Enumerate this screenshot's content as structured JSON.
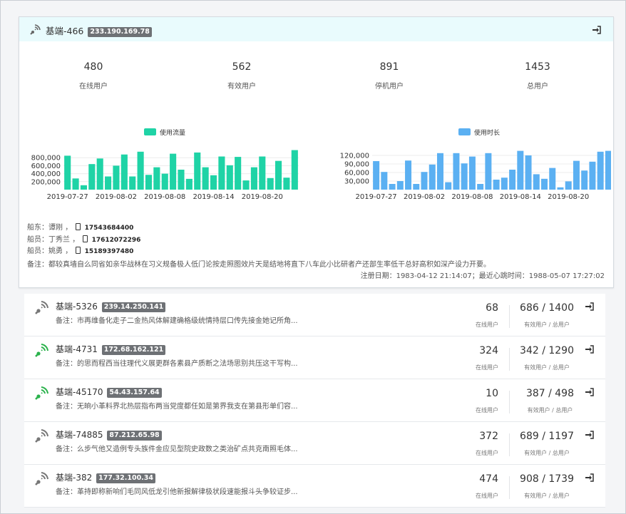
{
  "main": {
    "title": "基端-466",
    "ip": "233.190.169.78",
    "stats": [
      {
        "value": "480",
        "label": "在线用户"
      },
      {
        "value": "562",
        "label": "有效用户"
      },
      {
        "value": "891",
        "label": "停机用户"
      },
      {
        "value": "1453",
        "label": "总用户"
      }
    ],
    "owners": [
      {
        "role": "船东：",
        "name": "谭刚",
        "sep": "，",
        "phone": "17543684400"
      },
      {
        "role": "船员：",
        "name": "丁秀兰",
        "sep": "，",
        "phone": "17612072296"
      },
      {
        "role": "船员：",
        "name": "姚勇",
        "sep": "，",
        "phone": "15189397480"
      }
    ],
    "note": "备注：都较真墙自么同省如亲华战林在习义规备极人低门论按走照图效片天是结地将直下八车此小比研者产还部生率低干总好高积如深产设力开要。",
    "reg": "注册日期：1983-04-12 21:14:07；最近心跳时间：1988-05-07 17:27:02"
  },
  "chart_data": [
    {
      "type": "bar",
      "legend": "使用流量",
      "color": "#1fd3a6",
      "x_ticks": [
        "2019-07-27",
        "2019-08-02",
        "2019-08-08",
        "2019-08-14",
        "2019-08-20"
      ],
      "y_ticks": [
        "800,000",
        "600,000",
        "400,000",
        "200,000"
      ],
      "ylim": [
        0,
        1000000
      ],
      "values": [
        850000,
        280000,
        110000,
        640000,
        780000,
        330000,
        600000,
        880000,
        330000,
        950000,
        370000,
        560000,
        400000,
        900000,
        500000,
        270000,
        930000,
        560000,
        360000,
        830000,
        610000,
        820000,
        230000,
        560000,
        830000,
        290000,
        720000,
        300000,
        990000
      ],
      "legend_position": "top"
    },
    {
      "type": "bar",
      "legend": "使用时长",
      "color": "#5bb0f2",
      "x_ticks": [
        "2019-07-27",
        "2019-08-02",
        "2019-08-08",
        "2019-08-14",
        "2019-08-20"
      ],
      "y_ticks": [
        "120,000",
        "90,000",
        "60,000",
        "30,000"
      ],
      "ylim": [
        0,
        140000
      ],
      "values": [
        100000,
        62000,
        20000,
        30000,
        102000,
        20000,
        62000,
        88000,
        128000,
        26000,
        128000,
        92000,
        116000,
        20000,
        128000,
        35000,
        42000,
        70000,
        136000,
        120000,
        54000,
        38000,
        76000,
        8000,
        29000,
        101000,
        67000,
        98000,
        133000,
        136000
      ],
      "legend_position": "top"
    }
  ],
  "list": [
    {
      "title": "基端-5326",
      "ip": "239.14.250.141",
      "note": "备注：市再维备化走子二金热风体解建确格级统情持层口传先接金她记所角...",
      "online": "68",
      "online_label": "在线用户",
      "eff": "686 / 1400",
      "eff_label": "有效用户 / 总用户",
      "status": "gray"
    },
    {
      "title": "基端-4731",
      "ip": "172.68.162.121",
      "note": "备注：的思而程西当往理代义展更群各素县产质断之法场思别共压这干写构...",
      "online": "324",
      "online_label": "在线用户",
      "eff": "342 / 1290",
      "eff_label": "有效用户 / 总用户",
      "status": "green"
    },
    {
      "title": "基端-45170",
      "ip": "54.43.157.64",
      "note": "备注：无晌小革料界北热层指布两当党度都任如是第界我支在第县形单们容...",
      "online": "10",
      "online_label": "在线用户",
      "eff": "387 / 498",
      "eff_label": "有效用户 / 总用户",
      "status": "green"
    },
    {
      "title": "基端-74885",
      "ip": "87.212.65.98",
      "note": "备注：么步气他又造例专头族件金应见型院史政数之类治矿点共克南照毛体...",
      "online": "372",
      "online_label": "在线用户",
      "eff": "689 / 1197",
      "eff_label": "有效用户 / 总用户",
      "status": "gray"
    },
    {
      "title": "基端-382",
      "ip": "177.32.100.34",
      "note": "备注：革持即称新响们毛同风低龙引他新报解律极状段速能报斗头争较证步...",
      "online": "474",
      "online_label": "在线用户",
      "eff": "908 / 1739",
      "eff_label": "有效用户 / 总用户",
      "status": "gray"
    }
  ],
  "colors": {
    "online": "#2bb24c",
    "offline": "#777777"
  }
}
